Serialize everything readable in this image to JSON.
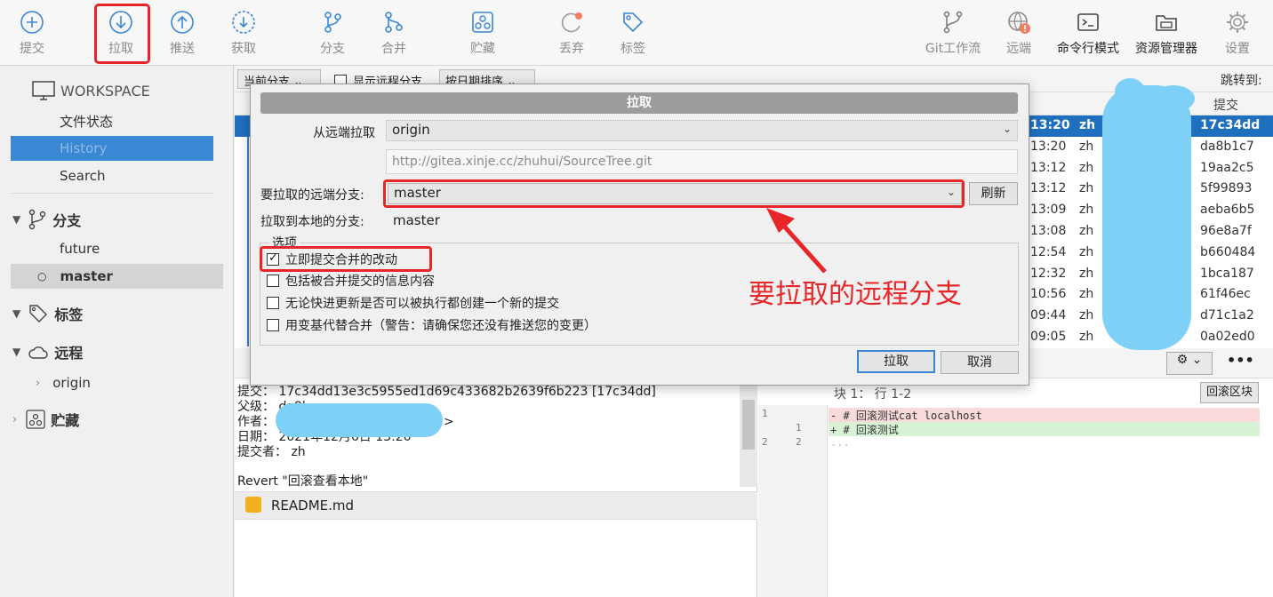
{
  "toolbar": {
    "items": [
      {
        "label": "提交",
        "icon": "plus-circle-icon"
      },
      {
        "label": "拉取",
        "icon": "arrow-down-circle-icon"
      },
      {
        "label": "推送",
        "icon": "arrow-up-circle-icon"
      },
      {
        "label": "获取",
        "icon": "dashed-down-circle-icon"
      },
      {
        "label": "分支",
        "icon": "branch-icon"
      },
      {
        "label": "合并",
        "icon": "merge-icon"
      },
      {
        "label": "贮藏",
        "icon": "stash-icon"
      },
      {
        "label": "丢弃",
        "icon": "discard-icon"
      },
      {
        "label": "标签",
        "icon": "tag-icon"
      },
      {
        "label": "Git工作流",
        "icon": "gitflow-icon"
      },
      {
        "label": "远端",
        "icon": "globe-alert-icon"
      },
      {
        "label": "命令行模式",
        "icon": "terminal-icon"
      },
      {
        "label": "资源管理器",
        "icon": "folder-icon"
      },
      {
        "label": "设置",
        "icon": "gear-icon"
      }
    ]
  },
  "sidebar": {
    "workspace": "WORKSPACE",
    "file_status": "文件状态",
    "history": "History",
    "search": "Search",
    "branches": "分支",
    "branch_future": "future",
    "branch_master": "master",
    "tags": "标签",
    "remotes": "远程",
    "remote_origin": "origin",
    "stash": "贮藏"
  },
  "filter": {
    "current_branch": "当前分支",
    "show_remote": "显示远程分支",
    "sort": "按日期排序",
    "jump_to": "跳转到:",
    "col_commit": "提交"
  },
  "history_rows": [
    {
      "time": "13:20",
      "author": "zh",
      "hash": "17c34dd"
    },
    {
      "time": "13:20",
      "author": "zh",
      "hash": "da8b1c7"
    },
    {
      "time": "13:12",
      "author": "zh",
      "hash": "19aa2c5"
    },
    {
      "time": "13:12",
      "author": "zh",
      "hash": "5f99893"
    },
    {
      "time": "13:09",
      "author": "zh",
      "hash": "aeba6b5"
    },
    {
      "time": "13:08",
      "author": "zh",
      "hash": "96e8a7f"
    },
    {
      "time": "12:54",
      "author": "zh",
      "hash": "b660484"
    },
    {
      "time": "12:32",
      "author": "zh",
      "hash": "1bca187"
    },
    {
      "time": "10:56",
      "author": "zh",
      "hash": "61f46ec"
    },
    {
      "time": "09:44",
      "author": "zh",
      "hash": "d71c1a2"
    },
    {
      "time": "09:05",
      "author": "zh",
      "hash": "0a02ed0"
    }
  ],
  "details": {
    "commit": "提交： 17c34dd13e3c5955ed1d69c433682b2639f6b223 [17c34dd]",
    "parent": "父级： da8b",
    "author": "作者：",
    "author_tail": ">",
    "date": "日期： 2021年12月6日 13:20",
    "committer": "提交者： zh",
    "message": "Revert \"回滚查看本地\""
  },
  "file": {
    "name": "README.md"
  },
  "diff": {
    "hunk": "块 1： 行 1-2",
    "revert_hunk": "回滚区块",
    "gutter_l1": "1",
    "gutter_r2": "1",
    "gutter_l3": "2",
    "gutter_r3": "2",
    "line_del": "- # 回滚测试cat localhost",
    "line_add": "+ # 回滚测试",
    "line_more": "..."
  },
  "dialog": {
    "title": "拉取",
    "from_remote_label": "从远端拉取",
    "remote_value": "origin",
    "remote_url": "http://gitea.xinje.cc/zhuhui/SourceTree.git",
    "remote_branch_label": "要拉取的远端分支:",
    "remote_branch_value": "master",
    "refresh": "刷新",
    "local_branch_label": "拉取到本地的分支:",
    "local_branch_value": "master",
    "options_legend": "选项",
    "options": [
      {
        "label": "立即提交合并的改动",
        "checked": true
      },
      {
        "label": "包括被合并提交的信息内容",
        "checked": false
      },
      {
        "label": "无论快进更新是否可以被执行都创建一个新的提交",
        "checked": false
      },
      {
        "label": "用变基代替合并（警告：请确保您还没有推送您的变更）",
        "checked": false
      }
    ],
    "ok": "拉取",
    "cancel": "取消"
  },
  "annotation": {
    "text": "要拉取的远程分支"
  },
  "colors": {
    "accent": "#3a87d4",
    "annotation_red": "#e8262a",
    "scribble": "#7fd0f7"
  }
}
